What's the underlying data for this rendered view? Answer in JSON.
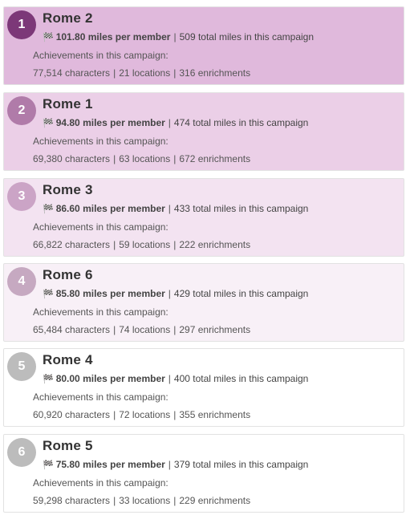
{
  "colors": {
    "card_bg": [
      "#e0b9dc",
      "#ebcfe7",
      "#f3e3f1",
      "#f8f0f7",
      "#ffffff",
      "#ffffff"
    ],
    "rank_bg": [
      "#7c3878",
      "#b07ba9",
      "#cba4c6",
      "#c6a9c1",
      "#bcbcbc",
      "#bcbcbc"
    ]
  },
  "flag_icon": "checkered-flag-icon",
  "achievements_label": "Achievements in this campaign:",
  "separator": "|",
  "teams": [
    {
      "rank": "1",
      "name": "Rome 2",
      "miles_per_member": "101.80 miles per member",
      "total_miles": "509 total miles in this campaign",
      "characters": "77,514 characters",
      "locations": "21 locations",
      "enrichments": "316 enrichments"
    },
    {
      "rank": "2",
      "name": "Rome 1",
      "miles_per_member": "94.80 miles per member",
      "total_miles": "474 total miles in this campaign",
      "characters": "69,380 characters",
      "locations": "63 locations",
      "enrichments": "672 enrichments"
    },
    {
      "rank": "3",
      "name": "Rome 3",
      "miles_per_member": "86.60 miles per member",
      "total_miles": "433 total miles in this campaign",
      "characters": "66,822 characters",
      "locations": "59 locations",
      "enrichments": "222 enrichments"
    },
    {
      "rank": "4",
      "name": "Rome 6",
      "miles_per_member": "85.80 miles per member",
      "total_miles": "429 total miles in this campaign",
      "characters": "65,484 characters",
      "locations": "74 locations",
      "enrichments": "297 enrichments"
    },
    {
      "rank": "5",
      "name": "Rome 4",
      "miles_per_member": "80.00 miles per member",
      "total_miles": "400 total miles in this campaign",
      "characters": "60,920 characters",
      "locations": "72 locations",
      "enrichments": "355 enrichments"
    },
    {
      "rank": "6",
      "name": "Rome 5",
      "miles_per_member": "75.80 miles per member",
      "total_miles": "379 total miles in this campaign",
      "characters": "59,298 characters",
      "locations": "33 locations",
      "enrichments": "229 enrichments"
    }
  ]
}
